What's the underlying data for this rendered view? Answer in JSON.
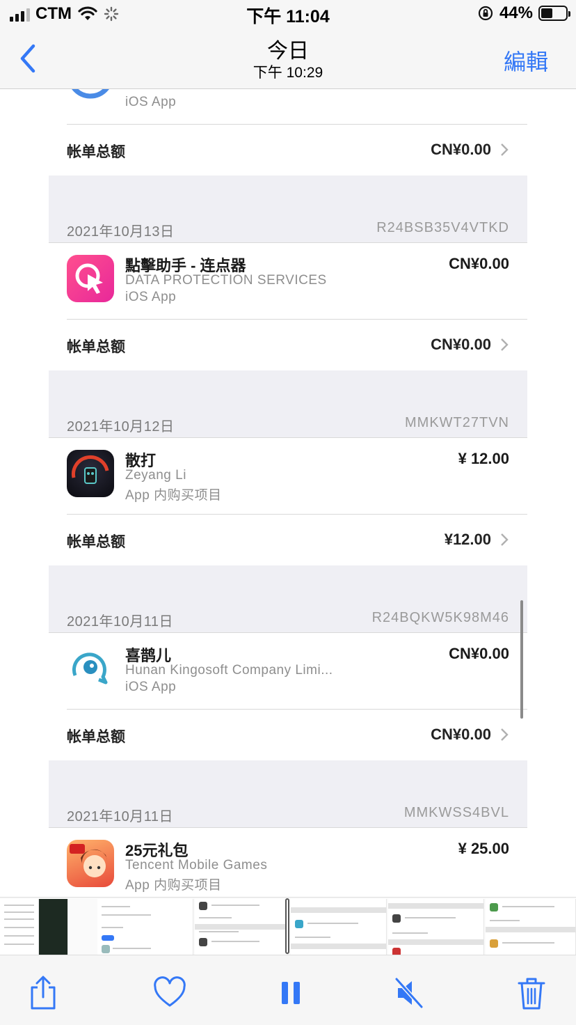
{
  "status_bar": {
    "carrier": "CTM",
    "time": "下午 11:04",
    "battery_percent": "44%",
    "battery_level": 0.44
  },
  "nav": {
    "title": "今日",
    "subtitle": "下午 10:29",
    "edit_label": "編輯"
  },
  "receipts": {
    "partial_top": {
      "app_type": "iOS App",
      "total_label": "帐单总额",
      "total_amount": "CN¥0.00"
    },
    "groups": [
      {
        "date": "2021年10月13日",
        "order_id": "R24BSB35V4VTKD",
        "app_name": "點擊助手 - 连点器",
        "developer": "DATA PROTECTION SERVICES",
        "app_type": "iOS App",
        "price": "CN¥0.00",
        "total_label": "帐单总额",
        "total_amount": "CN¥0.00"
      },
      {
        "date": "2021年10月12日",
        "order_id": "MMKWT27TVN",
        "app_name": "散打",
        "developer": "Zeyang Li",
        "app_type": "App 内购买项目",
        "price": "¥ 12.00",
        "total_label": "帐单总额",
        "total_amount": "¥12.00"
      },
      {
        "date": "2021年10月11日",
        "order_id": "R24BQKW5K98M46",
        "app_name": "喜鹊儿",
        "developer": "Hunan Kingosoft Company Limi...",
        "app_type": "iOS App",
        "price": "CN¥0.00",
        "total_label": "帐单总额",
        "total_amount": "CN¥0.00"
      },
      {
        "date": "2021年10月11日",
        "order_id": "MMKWSS4BVL",
        "app_name": "25元礼包",
        "developer": "Tencent Mobile Games",
        "app_type": "App 内购买项目",
        "price": "¥ 25.00"
      }
    ]
  },
  "toolbar": {
    "share_icon": "share-icon",
    "favorite_icon": "heart-icon",
    "pause_icon": "pause-icon",
    "mute_icon": "speaker-muted-icon",
    "delete_icon": "trash-icon"
  },
  "colors": {
    "accent": "#3478f6",
    "background": "#efeff4",
    "bar": "#f6f6f6"
  }
}
